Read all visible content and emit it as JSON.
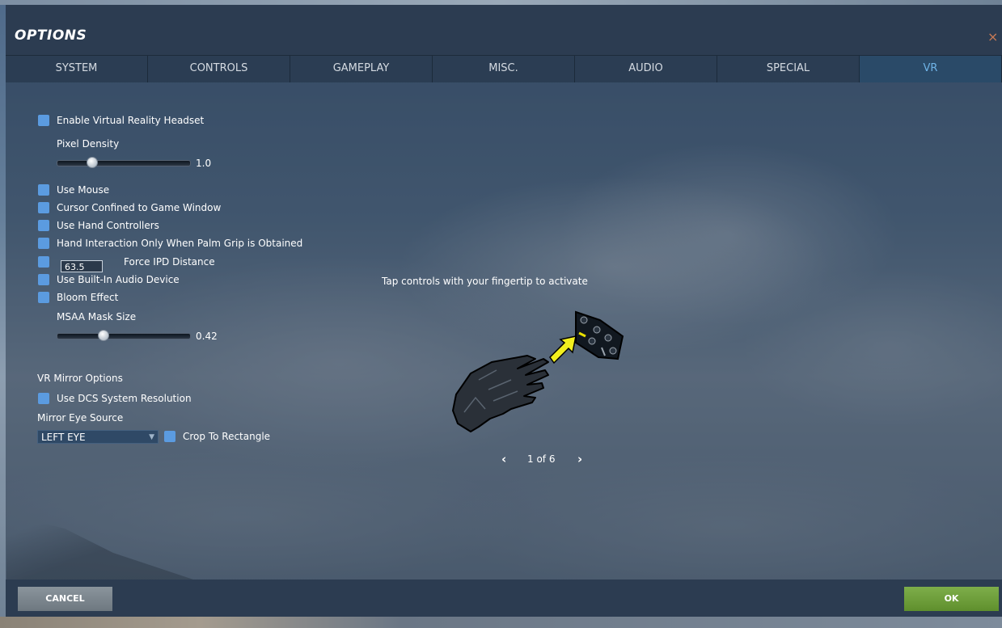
{
  "window": {
    "title": "OPTIONS",
    "close_glyph": "×"
  },
  "tabs": [
    {
      "label": "SYSTEM",
      "active": false
    },
    {
      "label": "CONTROLS",
      "active": false
    },
    {
      "label": "GAMEPLAY",
      "active": false
    },
    {
      "label": "MISC.",
      "active": false
    },
    {
      "label": "AUDIO",
      "active": false
    },
    {
      "label": "SPECIAL",
      "active": false
    },
    {
      "label": "VR",
      "active": true
    }
  ],
  "vr": {
    "enable_headset": {
      "label": "Enable Virtual Reality Headset",
      "checked": true
    },
    "pixel_density": {
      "label": "Pixel Density",
      "value": "1.0",
      "fraction": 0.25
    },
    "use_mouse": {
      "label": "Use Mouse",
      "checked": true
    },
    "cursor_confined": {
      "label": "Cursor Confined to Game Window",
      "checked": true
    },
    "use_hand_controllers": {
      "label": "Use Hand Controllers",
      "checked": true
    },
    "palm_grip": {
      "label": "Hand Interaction Only When Palm Grip is Obtained",
      "checked": true
    },
    "force_ipd": {
      "label": "Force IPD Distance",
      "value": "63.5",
      "checked": true
    },
    "builtin_audio": {
      "label": "Use Built-In Audio Device",
      "checked": true
    },
    "bloom": {
      "label": "Bloom Effect",
      "checked": true
    },
    "msaa_mask": {
      "label": "MSAA Mask Size",
      "value": "0.42",
      "fraction": 0.35
    },
    "mirror_options_heading": "VR Mirror Options",
    "use_dcs_resolution": {
      "label": "Use DCS System Resolution",
      "checked": true
    },
    "mirror_eye_label": "Mirror Eye Source",
    "mirror_eye_value": "LEFT EYE",
    "crop_rectangle": {
      "label": "Crop To Rectangle",
      "checked": true
    }
  },
  "tutorial": {
    "caption": "Tap controls with your fingertip to activate",
    "page": "1 of 6",
    "prev_glyph": "‹",
    "next_glyph": "›"
  },
  "footer": {
    "cancel_label": "CANCEL",
    "ok_label": "OK"
  },
  "colors": {
    "checkbox": "#5b9be0",
    "active_tab_text": "#6fb3e6",
    "ok": "#6c9d3a",
    "cancel": "#7c868e"
  }
}
